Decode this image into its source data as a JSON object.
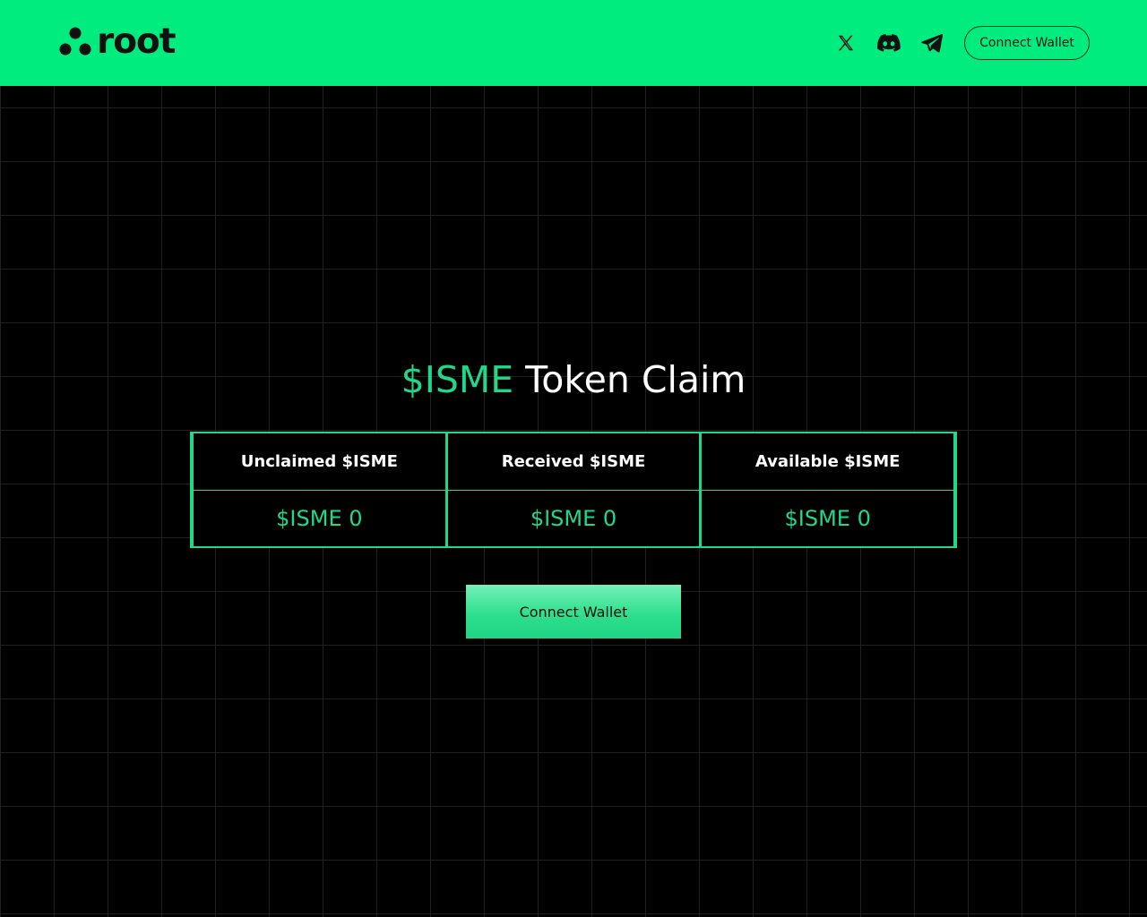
{
  "colors": {
    "header_bg": "#00ec7e",
    "accent": "#1fd88a",
    "page_bg": "#000000",
    "grid_line": "#202020"
  },
  "header": {
    "logo_text": "root",
    "logo_icon": "three-dots-logo-icon",
    "social": [
      {
        "icon": "x-icon"
      },
      {
        "icon": "discord-icon"
      },
      {
        "icon": "telegram-icon"
      }
    ],
    "connect_label": "Connect Wallet"
  },
  "main": {
    "title_accent": "$ISME",
    "title_rest": "Token Claim",
    "stats": [
      {
        "label": "Unclaimed $ISME",
        "value": "$ISME 0"
      },
      {
        "label": "Received $ISME",
        "value": "$ISME 0"
      },
      {
        "label": "Available $ISME",
        "value": "$ISME 0"
      }
    ],
    "connect_label": "Connect Wallet"
  }
}
